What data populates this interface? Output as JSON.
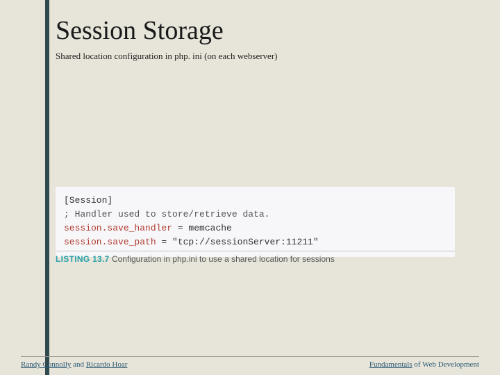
{
  "title": "Session Storage",
  "subtitle": "Shared location configuration in php. ini (on each webserver)",
  "code": {
    "section": "[Session]",
    "comment": "; Handler used to store/retrieve data.",
    "line1_key": "session.save_handler",
    "line1_rest": " = memcache",
    "line2_key": "session.save_path",
    "line2_rest": " = \"tcp://sessionServer:11211\""
  },
  "listing": {
    "label": "LISTING 13.7",
    "caption": " Configuration in php.ini to use a shared location for sessions"
  },
  "footer": {
    "left_a": "Randy Connolly",
    "left_mid": " and ",
    "left_b": "Ricardo Hoar",
    "right_a": "Fundamentals",
    "right_rest": " of Web Development"
  }
}
